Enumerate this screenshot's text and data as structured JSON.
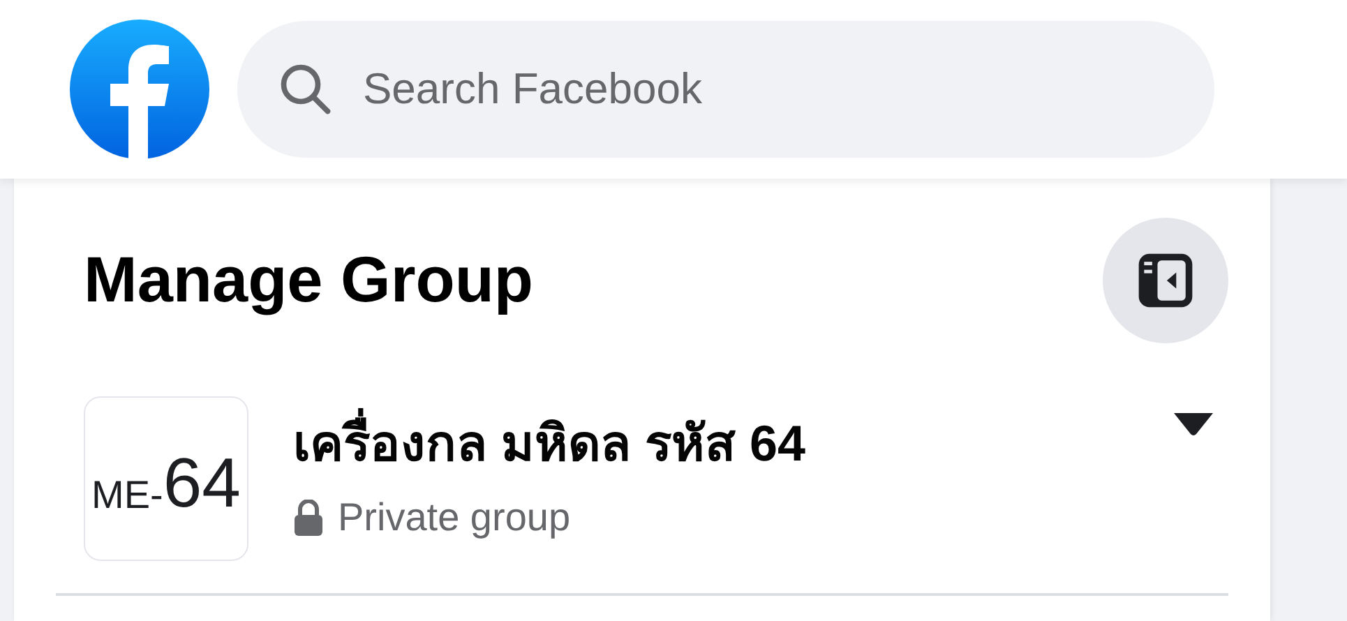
{
  "search": {
    "placeholder": "Search Facebook"
  },
  "sidebar": {
    "title": "Manage Group",
    "group": {
      "avatar_prefix": "ME-",
      "avatar_number": "64",
      "name": "เครื่องกล มหิดล รหัส 64",
      "privacy": "Private group"
    }
  }
}
